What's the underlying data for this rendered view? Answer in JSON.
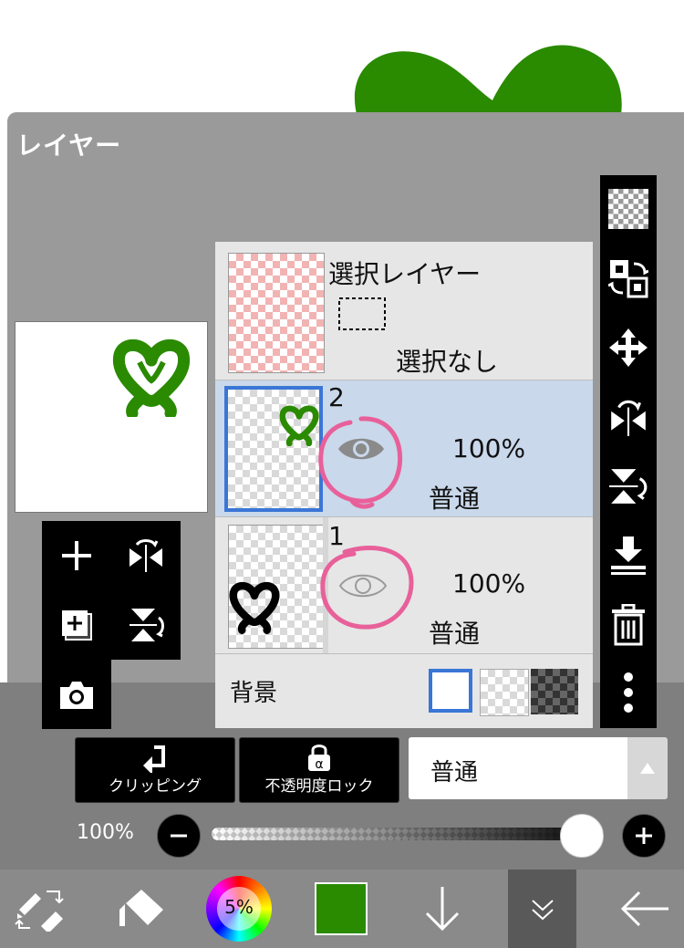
{
  "panel": {
    "title": "レイヤー"
  },
  "selection_layer": {
    "name": "選択レイヤー",
    "status": "選択なし"
  },
  "layers": [
    {
      "number": "2",
      "opacity": "100%",
      "blend": "普通",
      "selected": true
    },
    {
      "number": "1",
      "opacity": "100%",
      "blend": "普通",
      "selected": false
    }
  ],
  "background": {
    "label": "背景"
  },
  "controls": {
    "clipping_label": "クリッピング",
    "alpha_lock_label": "不透明度ロック",
    "blend_mode_value": "普通",
    "opacity_value": "100%",
    "opacity_fraction": 1.0
  },
  "bottom_toolbar": {
    "brush_size": "5%",
    "current_color": "#2a8a00"
  },
  "colors": {
    "accent_selected": "#3a76d6",
    "annotation_pink": "#e8609a",
    "heart_green": "#2a8a00"
  },
  "icons": {
    "add": "plus-icon",
    "flip": "flip-horizontal-icon",
    "copy": "duplicate-layer-icon",
    "rotate": "flip-vertical-icon",
    "camera": "camera-icon",
    "visibility": "eye-icon",
    "transparency": "checker-icon",
    "select": "selection-transform-icon",
    "move": "move-icon",
    "flip_h": "flip-horizontal-icon",
    "flip_v": "flip-vertical-icon",
    "merge_down": "merge-down-icon",
    "delete": "trash-icon",
    "more": "more-vertical-icon"
  }
}
